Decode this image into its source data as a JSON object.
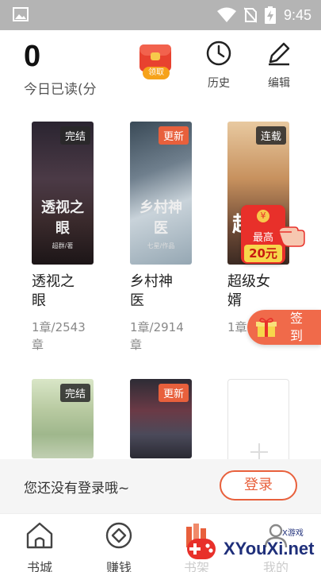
{
  "status_bar": {
    "time": "9:45",
    "icons": [
      "image-icon",
      "wifi-icon",
      "no-sim-icon",
      "battery-charging-icon"
    ]
  },
  "header": {
    "read_count": "0",
    "read_label": "今日已读(分",
    "redpacket_tag": "领取",
    "history_label": "历史",
    "edit_label": "编辑"
  },
  "books": [
    {
      "title": "透视之眼",
      "progress": "1章/2543章",
      "badge": "完结",
      "cover_title": "透视之眼",
      "cover_author": "超群/著"
    },
    {
      "title": "乡村神医",
      "progress": "1章/2914章",
      "badge": "更新",
      "cover_title": "乡村神医",
      "cover_author": "七星/作品"
    },
    {
      "title": "超级女婿",
      "progress": "1章",
      "badge": "连载",
      "cover_title": "超",
      "cover_author": ""
    },
    {
      "title": "",
      "progress": "",
      "badge": "完结",
      "cover_title": "",
      "cover_author": ""
    },
    {
      "title": "",
      "progress": "",
      "badge": "更新",
      "cover_title": "",
      "cover_author": ""
    }
  ],
  "promo": {
    "yuan_symbol": "¥",
    "max_label": "最高",
    "amount": "20元"
  },
  "checkin": {
    "label": "签到"
  },
  "login_bar": {
    "message": "您还没有登录哦~",
    "button": "登录"
  },
  "bottom_nav": [
    {
      "label": "书城",
      "icon": "home-icon"
    },
    {
      "label": "赚钱",
      "icon": "coin-icon"
    },
    {
      "label": "书架",
      "icon": "bookshelf-icon"
    },
    {
      "label": "我的",
      "icon": "profile-icon"
    }
  ],
  "watermark": {
    "text": "XYouXi.net",
    "sub": "X游戏"
  },
  "colors": {
    "accent": "#e8603c",
    "status_bar": "#b4b4b4",
    "promo_red": "#e8302a"
  }
}
